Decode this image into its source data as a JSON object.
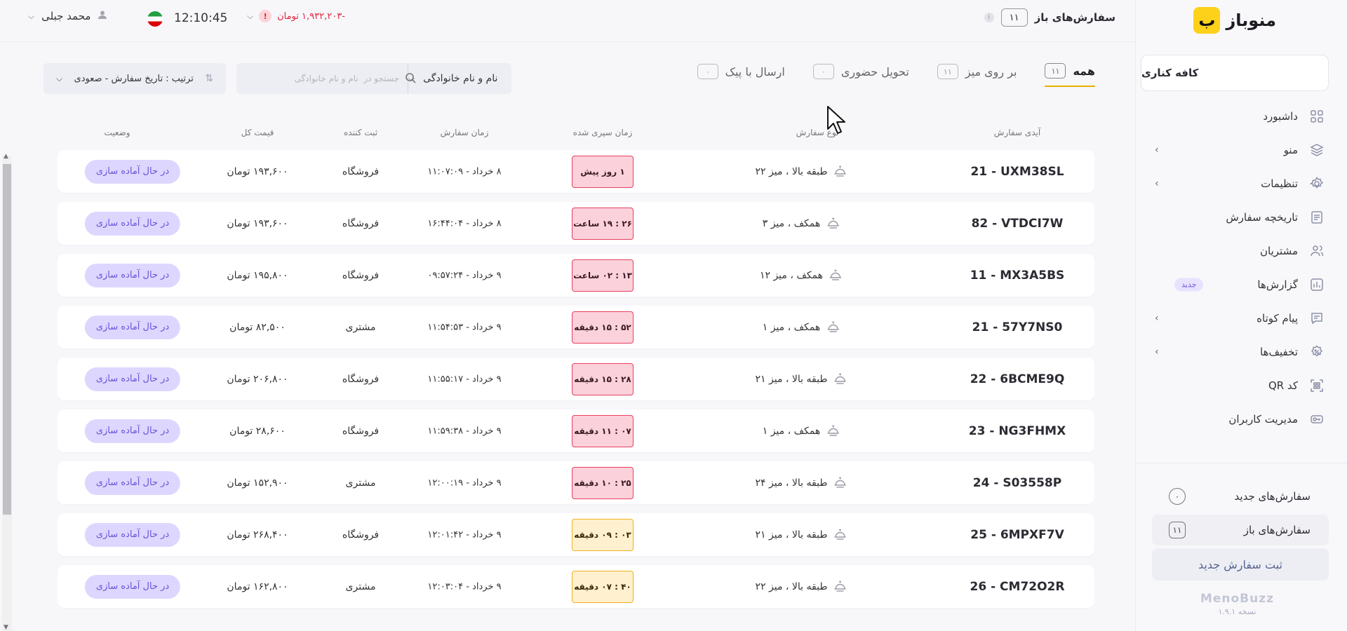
{
  "brand": {
    "name": "منوباز",
    "logo_glyph": "ب"
  },
  "sidebar": {
    "cafe": "کافه کناری",
    "items": [
      {
        "label": "داشبورد",
        "icon": "grid-icon",
        "chevron": false
      },
      {
        "label": "منو",
        "icon": "layers-icon",
        "chevron": true
      },
      {
        "label": "تنظیمات",
        "icon": "gear-icon",
        "chevron": true
      },
      {
        "label": "تاریخچه سفارش",
        "icon": "document-icon",
        "chevron": false
      },
      {
        "label": "مشتریان",
        "icon": "users-icon",
        "chevron": false
      },
      {
        "label": "گزارش‌ها",
        "icon": "bar-chart-icon",
        "chevron": false,
        "badge": "جدید"
      },
      {
        "label": "پیام کوتاه",
        "icon": "message-icon",
        "chevron": true
      },
      {
        "label": "تخفیف‌ها",
        "icon": "discount-icon",
        "chevron": true
      },
      {
        "label": "کد QR",
        "icon": "qr-icon",
        "chevron": false
      },
      {
        "label": "مدیریت کاربران",
        "icon": "key-icon",
        "chevron": false
      }
    ],
    "bottom": {
      "new_orders": "سفارش‌های جدید",
      "new_orders_count": "۰",
      "open_orders": "سفارش‌های باز",
      "open_orders_count": "۱۱",
      "new_order_button": "ثبت سفارش جدید"
    },
    "footer_name": "MenoBuzz",
    "footer_version": "نسخه ۱.۹.۱"
  },
  "header": {
    "open_orders_label": "سفارش‌های باز",
    "open_orders_count": "۱۱",
    "info_glyph": "i",
    "balance": "-۱,۹۳۲,۲۰۳ تومان",
    "balance_warn": "!",
    "clock": "12:10:45",
    "user_name": "محمد جبلی"
  },
  "tabs": [
    {
      "label": "همه",
      "count": "۱۱",
      "active": true
    },
    {
      "label": "بر روی میز",
      "count": "۱۱",
      "active": false
    },
    {
      "label": "تحویل حضوری",
      "count": "۰",
      "active": false
    },
    {
      "label": "ارسال با پیک",
      "count": "۰",
      "active": false
    }
  ],
  "filter": {
    "field_label": "نام و نام خانوادگی",
    "search_placeholder": "جستجو در  نام و نام خانوادگی",
    "sort_label": "ترتیب : تاریخ سفارش - صعودی"
  },
  "table": {
    "headers": {
      "id": "آیدی سفارش",
      "type": "نوع سفارش",
      "elapsed": "زمان سپری شده",
      "time": "زمان سفارش",
      "registrar": "ثبت کننده",
      "price": "قیمت کل",
      "status": "وضعیت"
    },
    "rows": [
      {
        "id": "21 - UXM38SL",
        "type": "طبقه بالا ، میز ۲۲",
        "elapsed": "۱ روز پیش",
        "level": "red",
        "time": "۸ خرداد - ۱۱:۰۷:۰۹",
        "registrar": "فروشگاه",
        "price": "۱۹۳,۶۰۰ تومان",
        "status": "در حال آماده سازی"
      },
      {
        "id": "82 - VTDCI7W",
        "type": "همکف ، میز ۳",
        "elapsed": "۲۶ : ۱۹ ساعت",
        "level": "red",
        "time": "۸ خرداد - ۱۶:۴۴:۰۴",
        "registrar": "فروشگاه",
        "price": "۱۹۳,۶۰۰ تومان",
        "status": "در حال آماده سازی"
      },
      {
        "id": "11 - MX3A5BS",
        "type": "همکف ، میز ۱۲",
        "elapsed": "۱۳ : ۰۲ ساعت",
        "level": "red",
        "time": "۹ خرداد - ۰۹:۵۷:۲۴",
        "registrar": "فروشگاه",
        "price": "۱۹۵,۸۰۰ تومان",
        "status": "در حال آماده سازی"
      },
      {
        "id": "21 - 57Y7NS0",
        "type": "همکف ، میز ۱",
        "elapsed": "۵۲ : ۱۵ دقیقه",
        "level": "red",
        "time": "۹ خرداد - ۱۱:۵۴:۵۳",
        "registrar": "مشتری",
        "price": "۸۲,۵۰۰ تومان",
        "status": "در حال آماده سازی"
      },
      {
        "id": "22 - 6BCME9Q",
        "type": "طبقه بالا ، میز ۲۱",
        "elapsed": "۲۸ : ۱۵ دقیقه",
        "level": "red",
        "time": "۹ خرداد - ۱۱:۵۵:۱۷",
        "registrar": "فروشگاه",
        "price": "۲۰۶,۸۰۰ تومان",
        "status": "در حال آماده سازی"
      },
      {
        "id": "23 - NG3FHMX",
        "type": "همکف ، میز ۱",
        "elapsed": "۰۷ : ۱۱ دقیقه",
        "level": "red",
        "time": "۹ خرداد - ۱۱:۵۹:۳۸",
        "registrar": "فروشگاه",
        "price": "۲۸,۶۰۰ تومان",
        "status": "در حال آماده سازی"
      },
      {
        "id": "24 - S03558P",
        "type": "طبقه بالا ، میز ۲۴",
        "elapsed": "۲۵ : ۱۰ دقیقه",
        "level": "red",
        "time": "۹ خرداد - ۱۲:۰۰:۱۹",
        "registrar": "مشتری",
        "price": "۱۵۲,۹۰۰ تومان",
        "status": "در حال آماده سازی"
      },
      {
        "id": "25 - 6MPXF7V",
        "type": "طبقه بالا ، میز ۲۱",
        "elapsed": "۰۳ : ۰۹ دقیقه",
        "level": "amber",
        "time": "۹ خرداد - ۱۲:۰۱:۴۲",
        "registrar": "فروشگاه",
        "price": "۲۶۸,۴۰۰ تومان",
        "status": "در حال آماده سازی"
      },
      {
        "id": "26 - CM72O2R",
        "type": "طبقه بالا ، میز ۲۲",
        "elapsed": "۴۰ : ۰۷ دقیقه",
        "level": "amber",
        "time": "۹ خرداد - ۱۲:۰۳:۰۴",
        "registrar": "مشتری",
        "price": "۱۶۲,۸۰۰ تومان",
        "status": "در حال آماده سازی"
      }
    ]
  },
  "colors": {
    "accent": "#fdd11a",
    "status_bg": "#ddd7ff",
    "status_text": "#6753d8",
    "late_border": "#e63f5e",
    "warning_border": "#f0b020",
    "negative": "#e0253e"
  }
}
